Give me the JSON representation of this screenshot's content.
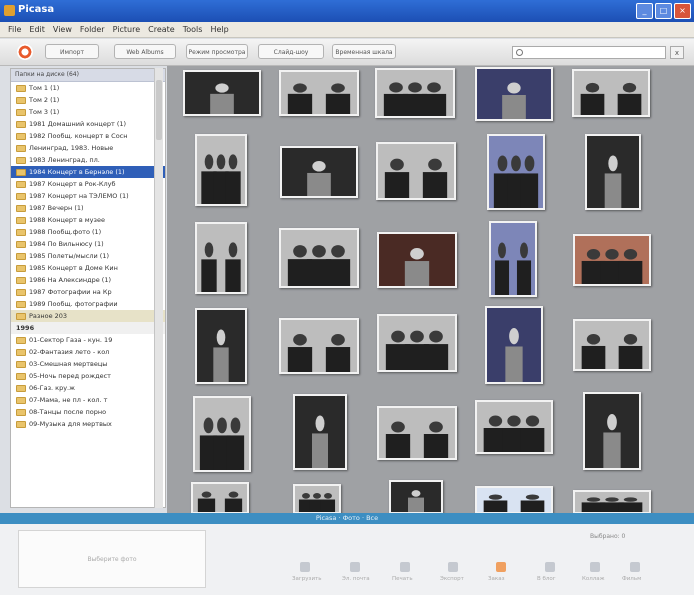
{
  "window": {
    "title": "Picasa"
  },
  "menu": [
    "File",
    "Edit",
    "View",
    "Folder",
    "Picture",
    "Create",
    "Tools",
    "Help"
  ],
  "toolbar": {
    "buttons": [
      "Импорт",
      "Web Albums",
      "Режим просмотра",
      "Слайд-шоу",
      "Временная шкала"
    ],
    "search_placeholder": ""
  },
  "tree": {
    "header": "Папки на диске (64)",
    "items": [
      "Том 1 (1)",
      "Том 2 (1)",
      "Том 3 (1)",
      "1981 Домашний концерт (1)",
      "1982 Пообщ. концерт в Сосн",
      "Ленинград, 1983. Новые",
      "1983 Ленинград, пл.",
      "1984 Концерт в Бернэле (1)",
      "1987 Концерт в Рок-Клуб",
      "1987 Концерт на ТЭЛЕМО (1)",
      "1987 Вечерн (1)",
      "1988 Концерт в музее",
      "1988 Пообщ.фото (1)",
      "1984 По Вильнюсу (1)",
      "1985 Полеты/мысли (1)",
      "1985 Концерт в Доме Кин",
      "1986 На Алексиндре (1)",
      "1987 Фотографии на Кр",
      "1989 Пообщ. фотографии",
      "Разное 203"
    ],
    "group": "1996",
    "group_items": [
      "01-Сектор Газа - кун. 19",
      "02-Фантазия лето - кол",
      "03-Смешная мертвецы",
      "05-Ночь перед рождест",
      "06-Газ. кру.ж",
      "07-Мама, не пл - кол. т",
      "08-Танцы после порно",
      "09-Музыка для мертвых"
    ]
  },
  "band": {
    "label": "Picasa · Фото · Все"
  },
  "tray": {
    "placeholder": "Выберите фото",
    "right_label": "Выбрано: 0",
    "actions": [
      "Загрузить",
      "Эл. почта",
      "Печать",
      "Экспорт",
      "Заказ",
      "В блог",
      "Коллаж",
      "Фильм"
    ]
  }
}
